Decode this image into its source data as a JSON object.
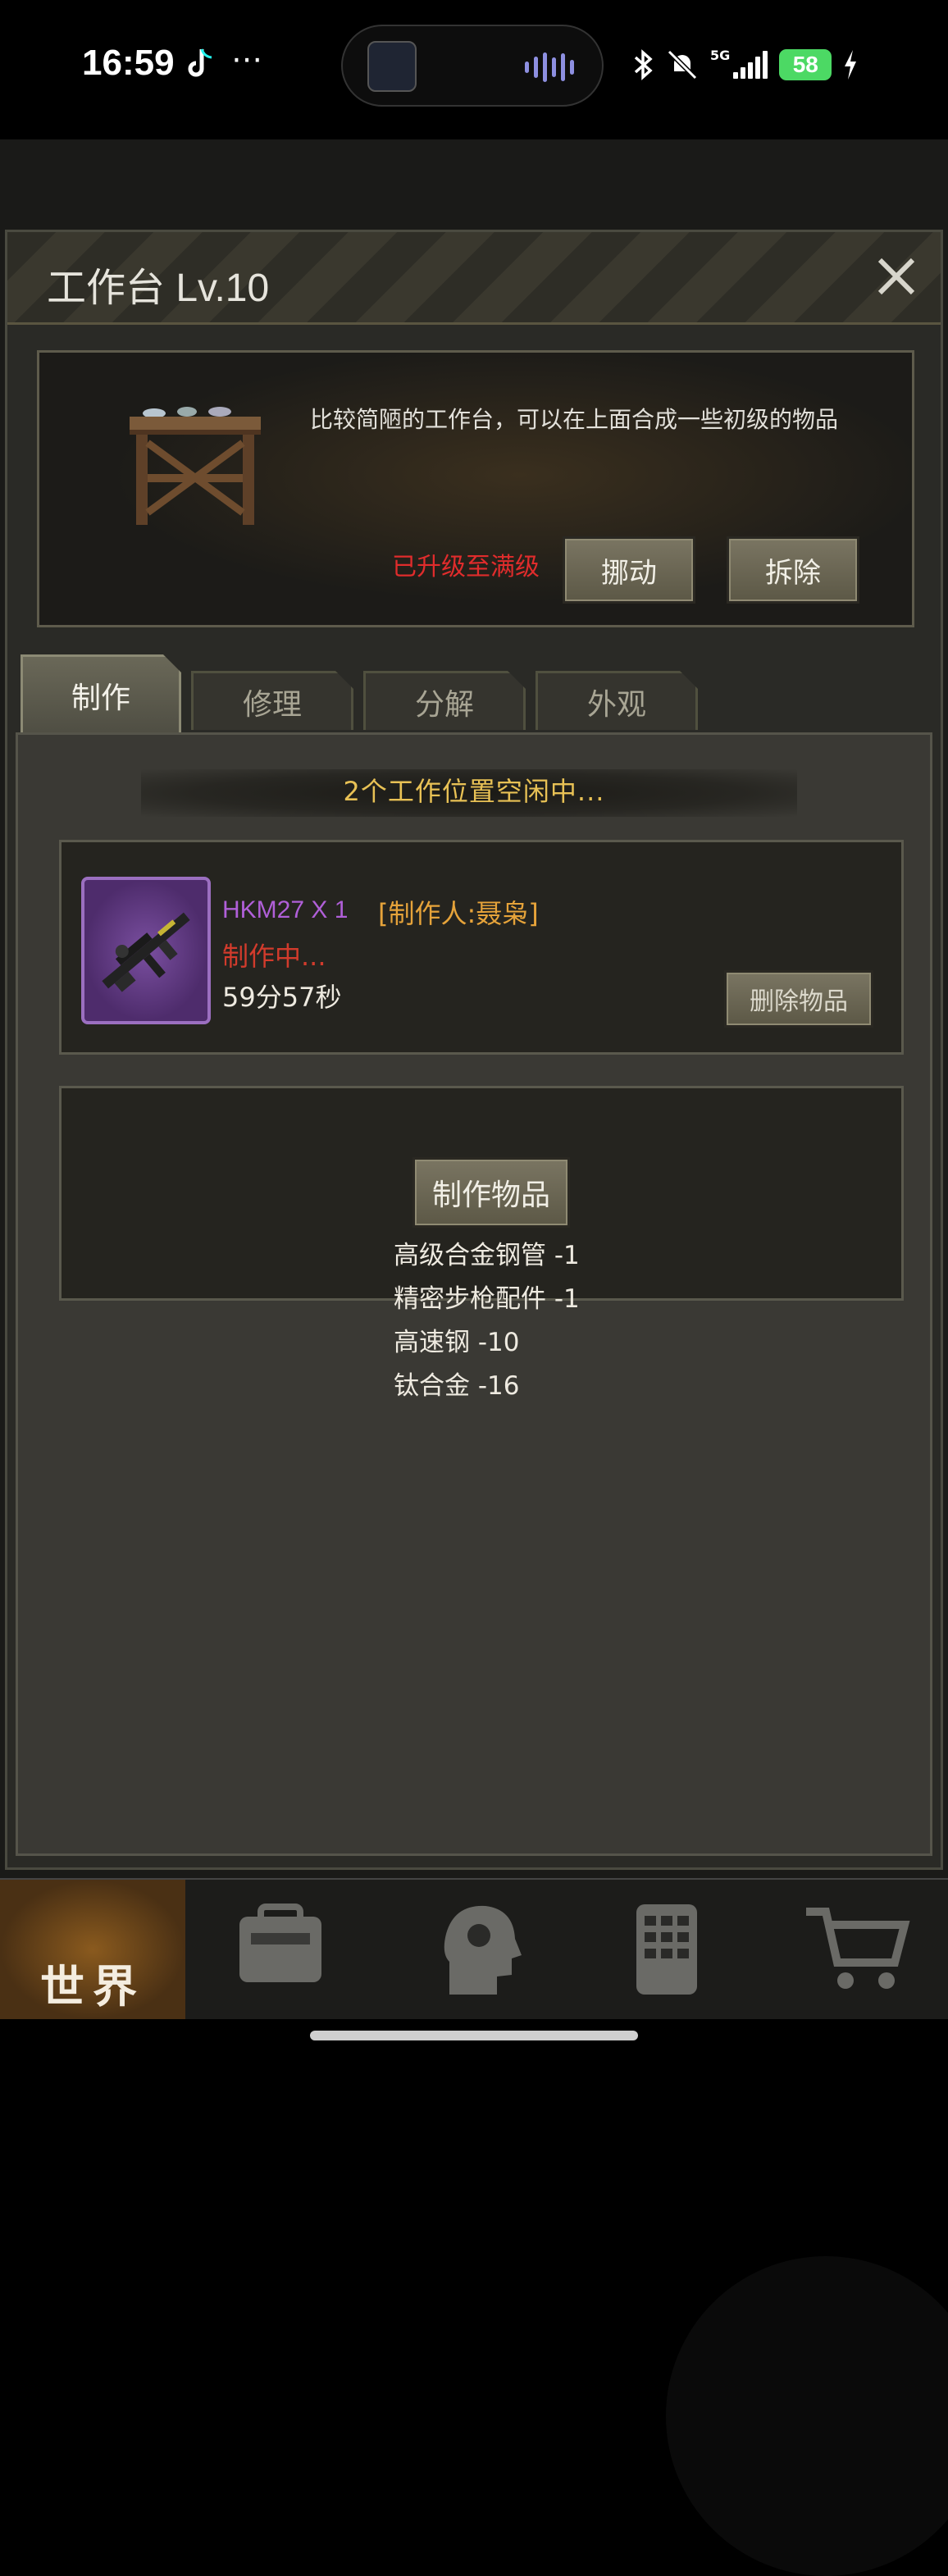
{
  "status_bar": {
    "time": "16:59",
    "network": "5G",
    "battery": "58"
  },
  "dialog": {
    "title": "工作台 Lv.10",
    "description": "比较简陋的工作台，可以在上面合成一些初级的物品",
    "max_level_text": "已升级至满级",
    "move_button": "挪动",
    "dismantle_button": "拆除"
  },
  "tabs": [
    {
      "label": "制作",
      "active": true
    },
    {
      "label": "修理",
      "active": false
    },
    {
      "label": "分解",
      "active": false
    },
    {
      "label": "外观",
      "active": false
    }
  ],
  "crafting": {
    "idle_status": "2个工作位置空闲中...",
    "slot": {
      "item_name": "HKM27 X 1",
      "maker": "[制作人:聂枭]",
      "status": "制作中...",
      "time_left": "59分57秒",
      "delete_button": "删除物品"
    },
    "craft_button": "制作物品",
    "materials": [
      "高级合金钢管 -1",
      "精密步枪配件 -1",
      "高速钢 -10",
      "钛合金 -16"
    ]
  },
  "bottom_nav": {
    "world_label": "世界"
  }
}
